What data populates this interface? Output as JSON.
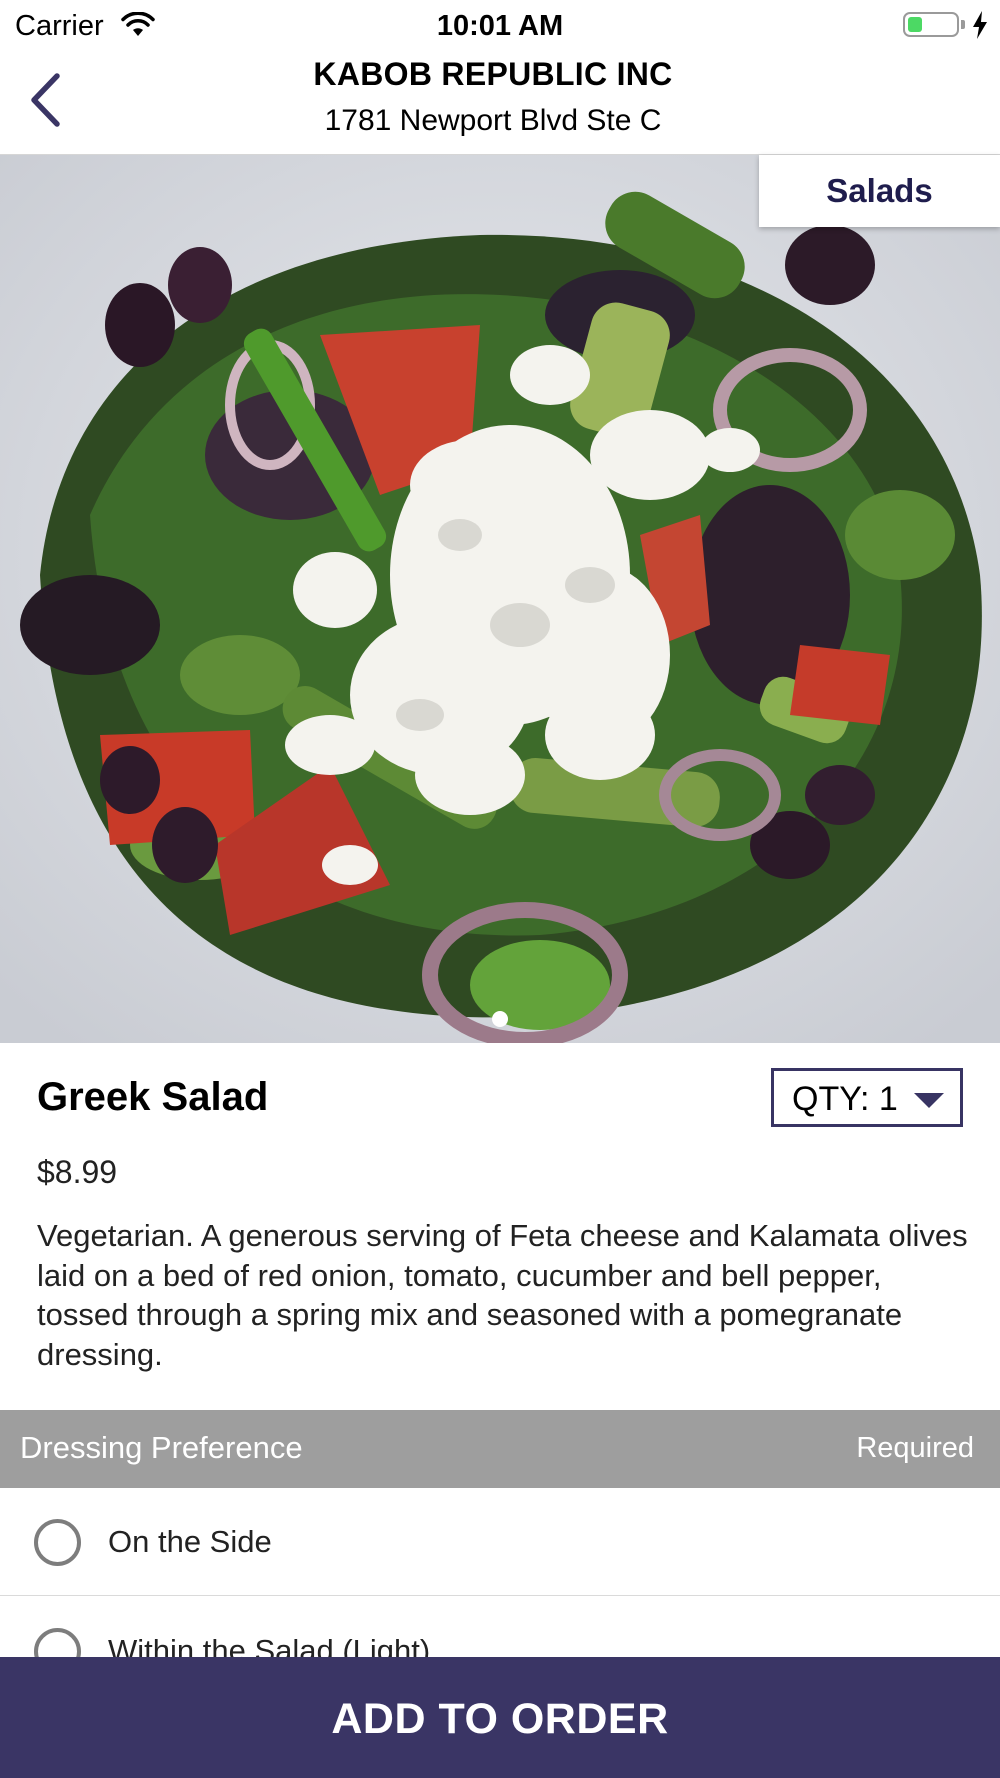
{
  "status_bar": {
    "carrier": "Carrier",
    "time": "10:01 AM",
    "battery_level": 0.3,
    "wifi_icon": "wifi-icon",
    "charging_icon": "bolt-icon"
  },
  "header": {
    "title": "KABOB REPUBLIC INC",
    "subtitle": "1781 Newport Blvd Ste C",
    "back_icon": "chevron-left-icon"
  },
  "hero": {
    "category": "Salads",
    "page_count": 1,
    "current_page": 1
  },
  "item": {
    "name": "Greek Salad",
    "price": "$8.99",
    "quantity_label": "QTY: 1",
    "description": "Vegetarian. A generous serving of Feta cheese and Kalamata olives laid on a bed of red onion, tomato, cucumber and bell pepper, tossed through a spring mix and seasoned with a pomegranate dressing."
  },
  "options_section": {
    "title": "Dressing Preference",
    "requirement": "Required",
    "options": [
      {
        "label": "On the Side",
        "selected": false
      },
      {
        "label": "Within the Salad (Light)",
        "selected": false
      }
    ]
  },
  "footer": {
    "add_button_label": "ADD TO ORDER"
  },
  "colors": {
    "brand": "#3a3565",
    "section_bar": "#9e9e9e",
    "battery": "#4cd964"
  }
}
